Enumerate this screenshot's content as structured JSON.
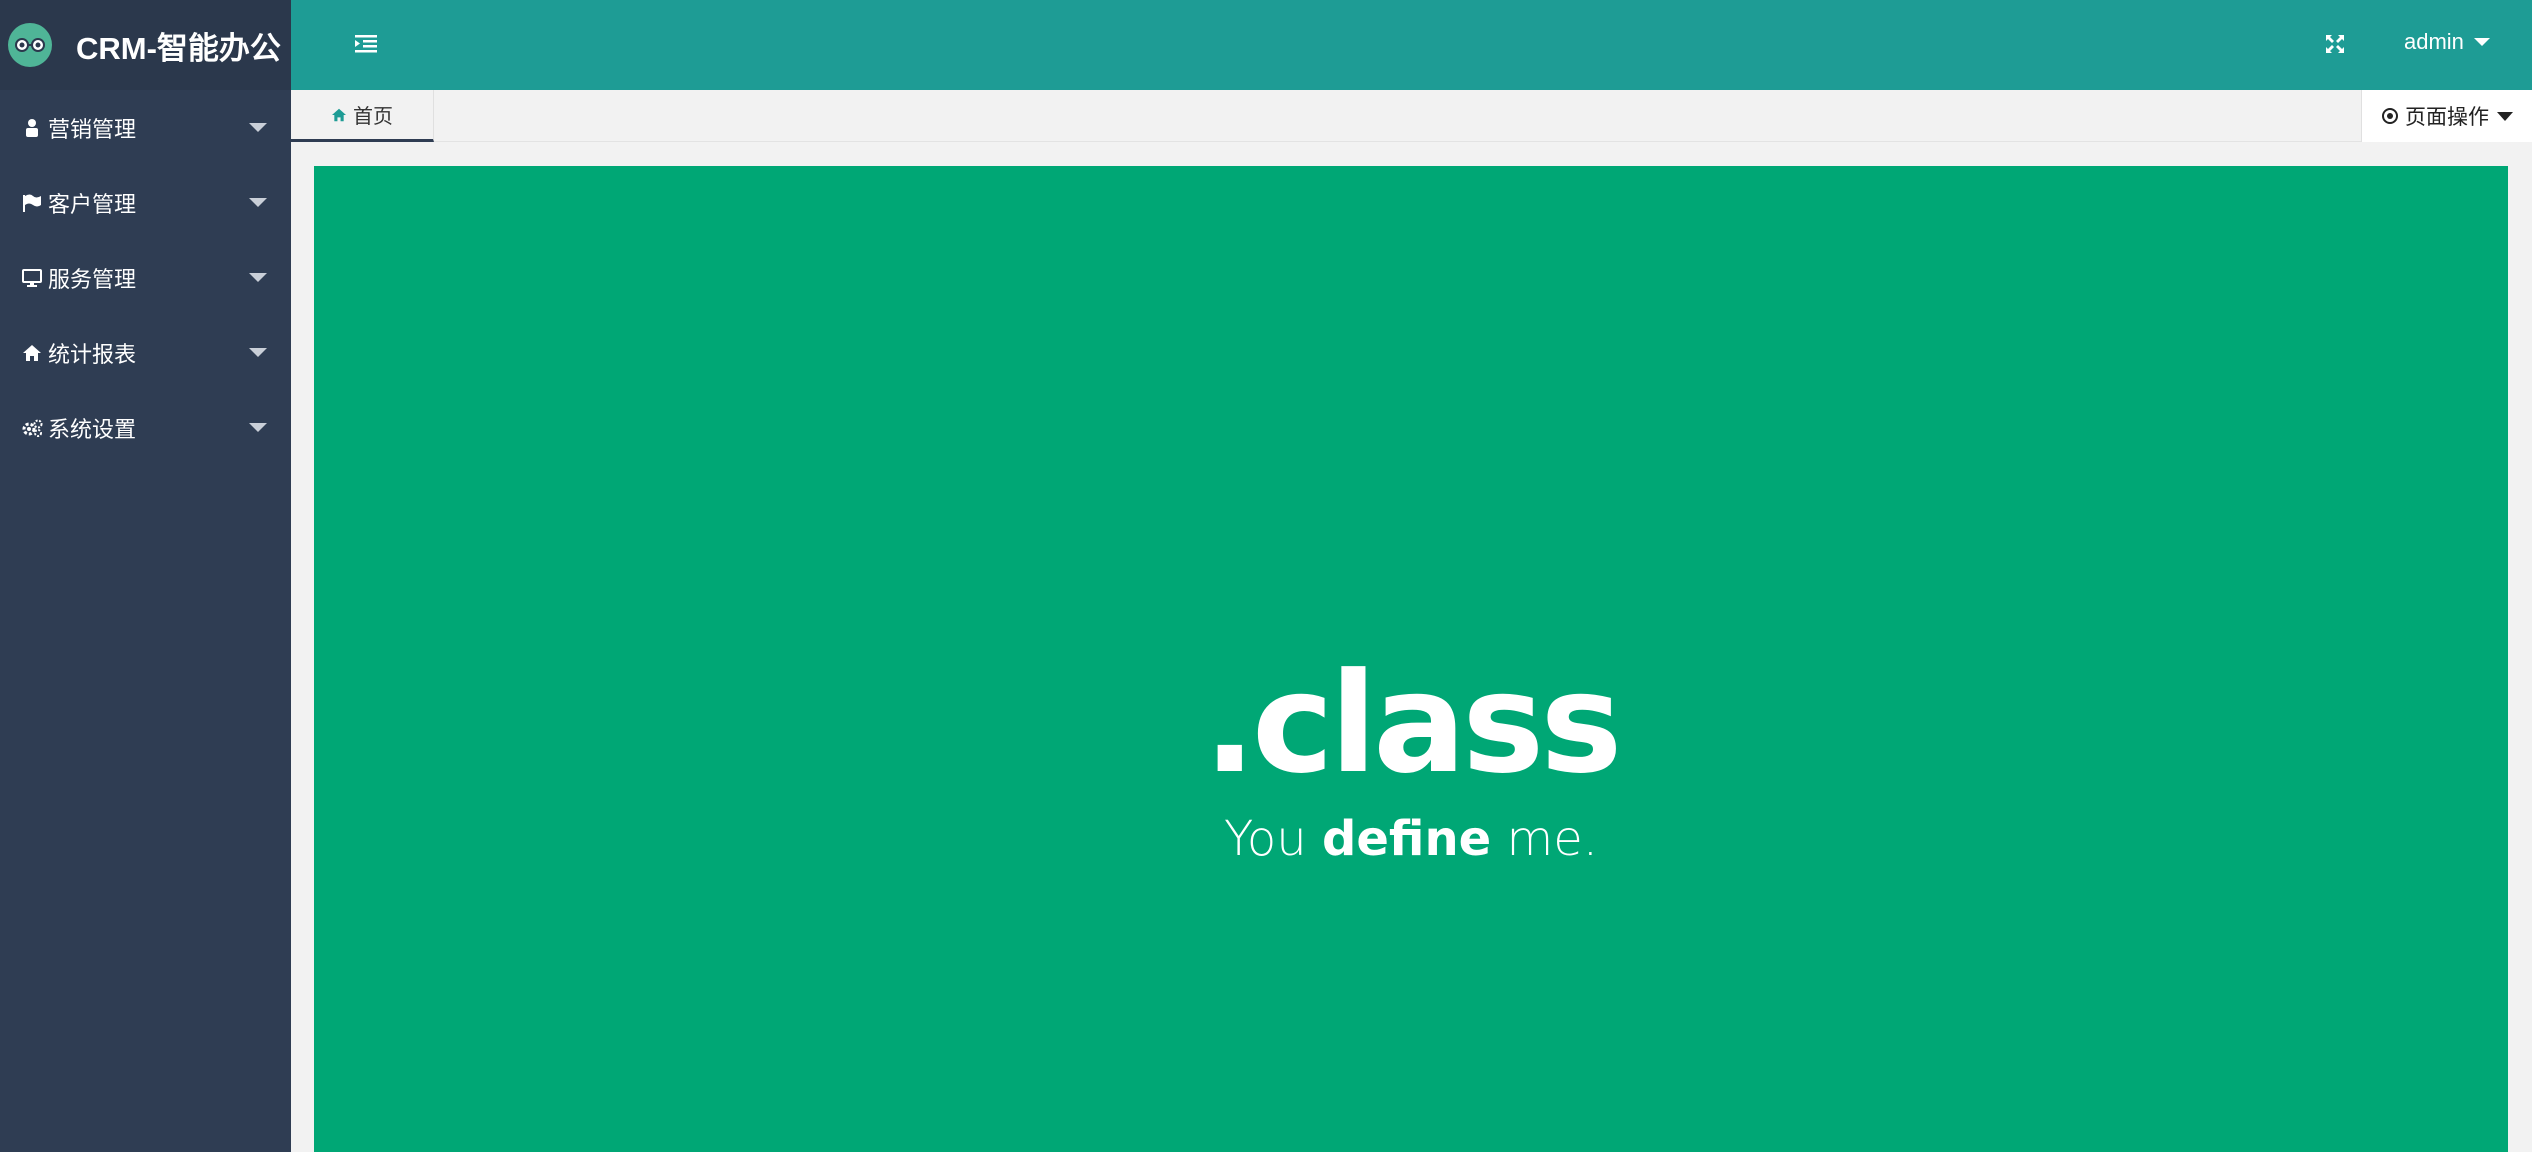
{
  "app": {
    "title": "CRM-智能办公"
  },
  "sidebar": {
    "items": [
      {
        "label": "营销管理",
        "icon": "user-icon"
      },
      {
        "label": "客户管理",
        "icon": "flag-icon"
      },
      {
        "label": "服务管理",
        "icon": "desktop-icon"
      },
      {
        "label": "统计报表",
        "icon": "home-icon"
      },
      {
        "label": "系统设置",
        "icon": "gears-icon"
      }
    ]
  },
  "header": {
    "user": "admin",
    "menu_toggle_icon": "indent-icon",
    "fullscreen_icon": "fullscreen-icon"
  },
  "tabs": {
    "home_label": "首页",
    "page_ops_label": "页面操作"
  },
  "content": {
    "hero_title": ".class",
    "hero_sub_prefix": "You",
    "hero_sub_bold": "define",
    "hero_sub_suffix": "me."
  },
  "colors": {
    "sidebar": "#2f3d53",
    "header": "#1e9c95",
    "content": "#00a775",
    "tab_active_border": "#2f3d53"
  }
}
